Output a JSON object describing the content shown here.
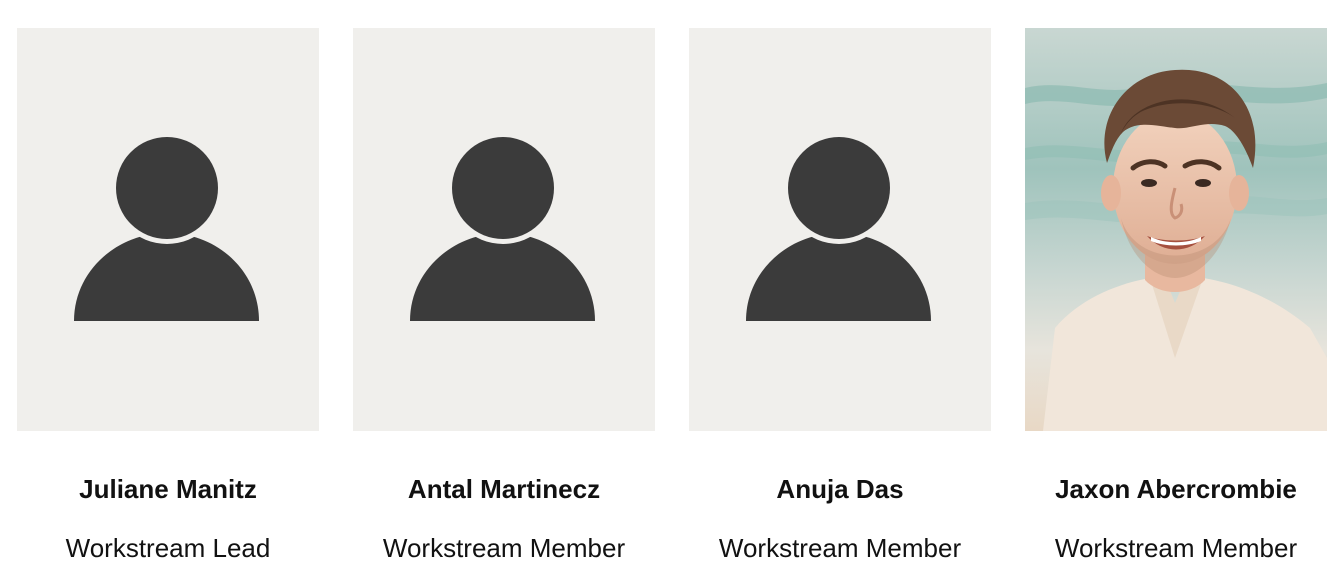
{
  "colors": {
    "card_background": "#f0efec",
    "silhouette": "#3b3b3b",
    "text": "#111111",
    "page_background": "#ffffff"
  },
  "members": [
    {
      "name": "Juliane Manitz",
      "role": "Workstream Lead",
      "photo": "placeholder-avatar-icon"
    },
    {
      "name": "Antal Martinecz",
      "role": "Workstream Member",
      "photo": "placeholder-avatar-icon"
    },
    {
      "name": "Anuja Das",
      "role": "Workstream Member",
      "photo": "placeholder-avatar-icon"
    },
    {
      "name": "Jaxon Abercrombie",
      "role": "Workstream Member",
      "photo": "portrait-photo"
    }
  ]
}
